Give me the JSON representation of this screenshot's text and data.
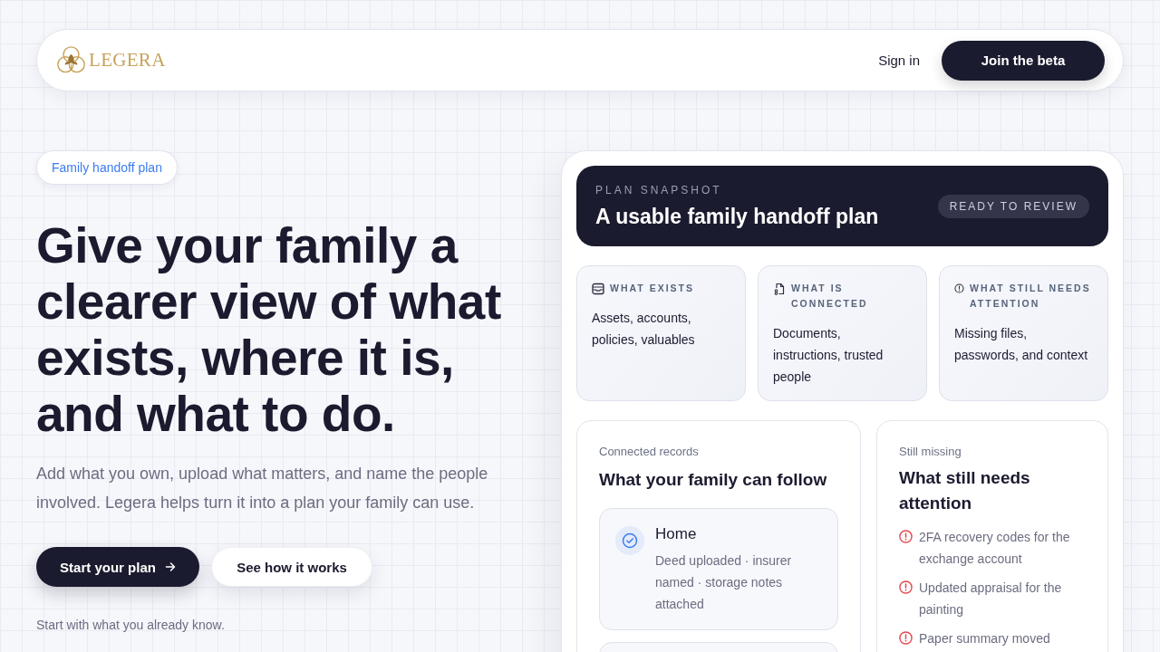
{
  "header": {
    "brand": "LEGERA",
    "sign_in": "Sign in",
    "cta": "Join the beta"
  },
  "hero": {
    "badge": "Family handoff plan",
    "title": "Give your family a clearer view of what exists, where it is, and what to do.",
    "lead": "Add what you own, upload what matters, and name the people involved. Legera helps turn it into a plan your family can use.",
    "buttons": [
      {
        "label": "Start your plan",
        "kind": "primary"
      },
      {
        "label": "See how it works",
        "kind": "secondary"
      }
    ],
    "note": "Start with what you already know."
  },
  "snapshot": {
    "eyebrow": "PLAN SNAPSHOT",
    "title": "A usable family handoff plan",
    "status": "READY TO REVIEW"
  },
  "summary": [
    {
      "kind": "exists",
      "label": "WHAT EXISTS",
      "text": "Assets, accounts, policies, valuables"
    },
    {
      "kind": "connected",
      "label": "WHAT IS CONNECTED",
      "text": "Documents, instructions, trusted people"
    },
    {
      "kind": "attention",
      "label": "WHAT STILL NEEDS ATTENTION",
      "text": "Missing files, passwords, and context"
    }
  ],
  "records": {
    "eyebrow": "Connected records",
    "title": "What your family can follow",
    "items": [
      {
        "title": "Home",
        "detail": "Deed uploaded · insurer named · storage notes attached"
      }
    ]
  },
  "missing": {
    "eyebrow": "Still missing",
    "title": "What still needs attention",
    "items": [
      "2FA recovery codes for the exchange account",
      "Updated appraisal for the painting",
      "Paper summary moved"
    ]
  }
}
